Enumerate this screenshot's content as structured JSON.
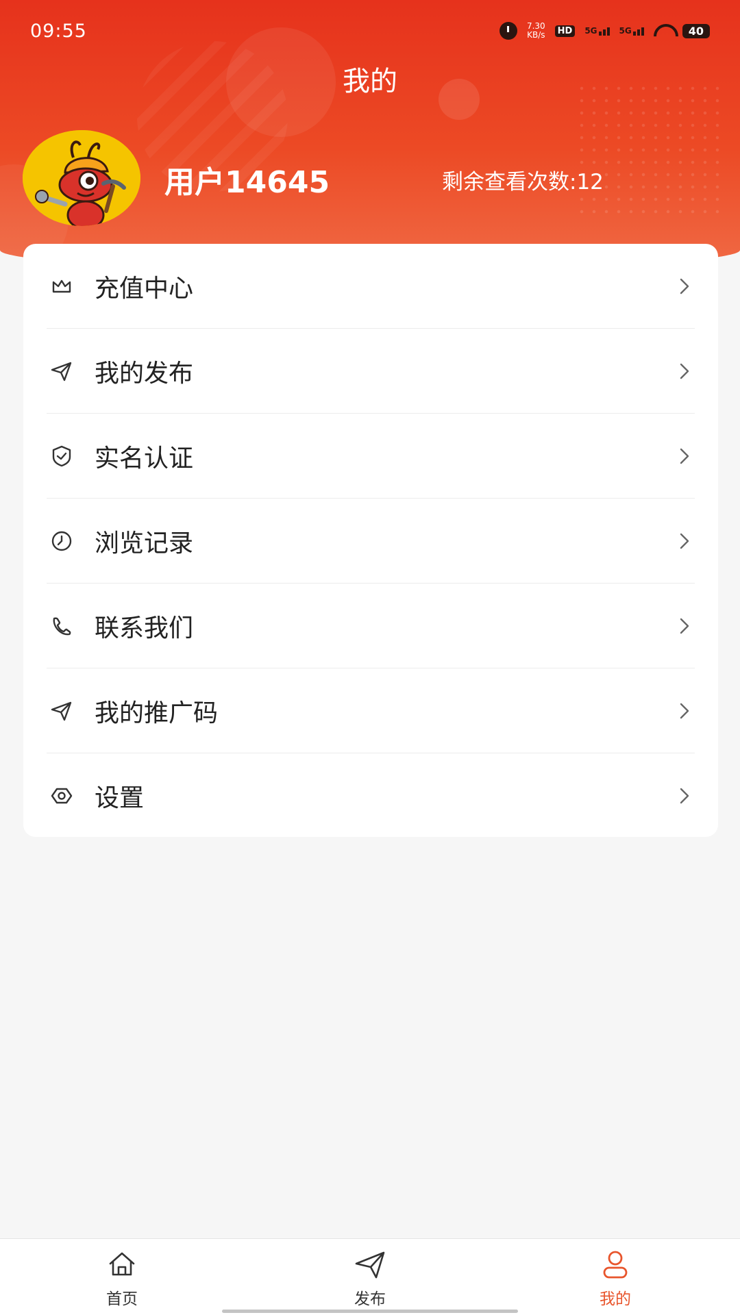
{
  "status_bar": {
    "time": "09:55",
    "net_speed": "7.30",
    "net_unit": "KB/s",
    "hd": "HD",
    "sim1": "5G",
    "sim2": "5G",
    "battery": "40"
  },
  "header": {
    "title": "我的",
    "username": "用户14645",
    "views_remaining": "剩余查看次数:12"
  },
  "menu": {
    "items": [
      {
        "label": "充值中心",
        "icon": "crown-icon"
      },
      {
        "label": "我的发布",
        "icon": "paper-plane-icon"
      },
      {
        "label": "实名认证",
        "icon": "shield-check-icon"
      },
      {
        "label": "浏览记录",
        "icon": "clock-icon"
      },
      {
        "label": "联系我们",
        "icon": "phone-icon"
      },
      {
        "label": "我的推广码",
        "icon": "paper-plane-icon"
      },
      {
        "label": "设置",
        "icon": "hexagon-gear-icon"
      }
    ]
  },
  "bottom_nav": {
    "items": [
      {
        "label": "首页",
        "icon": "home-icon",
        "active": false
      },
      {
        "label": "发布",
        "icon": "paper-plane-icon",
        "active": false
      },
      {
        "label": "我的",
        "icon": "user-icon",
        "active": true
      }
    ]
  },
  "colors": {
    "brand": "#e6321c",
    "active_tab": "#e8552c",
    "page_bg": "#f6f6f6"
  }
}
